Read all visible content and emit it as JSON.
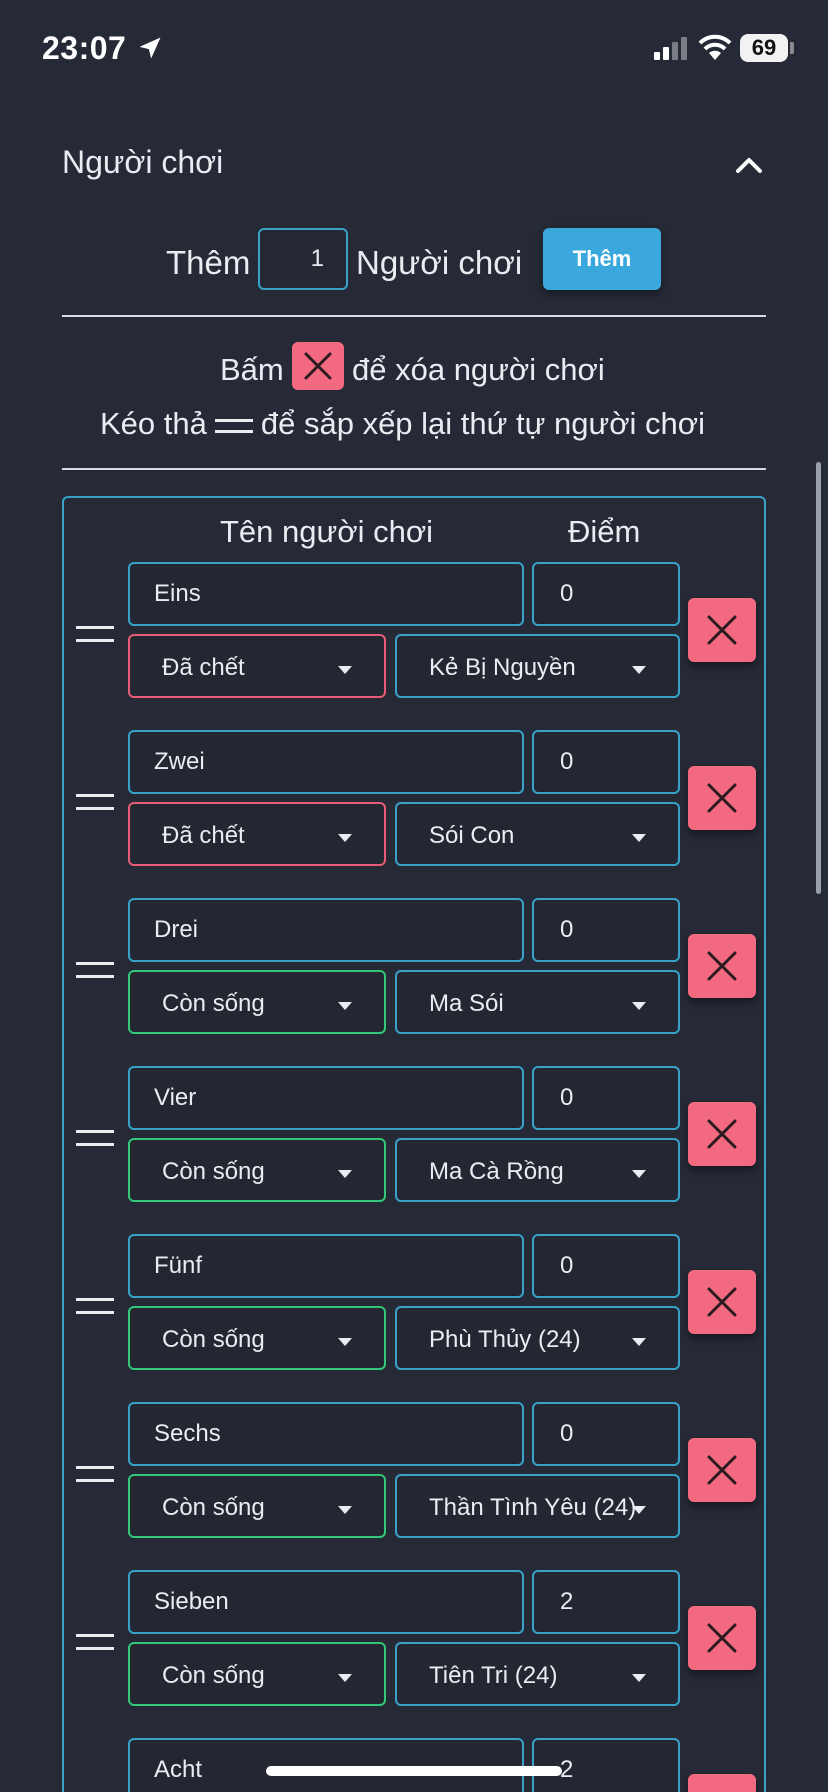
{
  "status_bar": {
    "time": "23:07",
    "battery": "69"
  },
  "section": {
    "title": "Người chơi"
  },
  "add_row": {
    "text_before": "Thêm",
    "count_value": "1",
    "text_after": "Người chơi",
    "button_label": "Thêm"
  },
  "hints": {
    "delete_before": "Bấm",
    "delete_after": "để xóa người chơi",
    "drag_before": "Kéo thả",
    "drag_after": "để sắp xếp lại thứ tự người chơi"
  },
  "table": {
    "col_name": "Tên người chơi",
    "col_score": "Điểm",
    "players": [
      {
        "name": "Eins",
        "score": "0",
        "status": "Đã chết",
        "role": "Kẻ Bị Nguyền"
      },
      {
        "name": "Zwei",
        "score": "0",
        "status": "Đã chết",
        "role": "Sói Con"
      },
      {
        "name": "Drei",
        "score": "0",
        "status": "Còn sống",
        "role": "Ma Sói"
      },
      {
        "name": "Vier",
        "score": "0",
        "status": "Còn sống",
        "role": "Ma Cà Rồng"
      },
      {
        "name": "Fünf",
        "score": "0",
        "status": "Còn sống",
        "role": "Phù Thủy (24)"
      },
      {
        "name": "Sechs",
        "score": "0",
        "status": "Còn sống",
        "role": "Thần Tình Yêu (24)"
      },
      {
        "name": "Sieben",
        "score": "2",
        "status": "Còn sống",
        "role": "Tiên Tri (24)"
      },
      {
        "name": "Acht",
        "score": "2",
        "status": "",
        "role": ""
      }
    ]
  },
  "colors": {
    "accent": "#3aa2c9",
    "dead": "#e85b74",
    "alive": "#34c77a",
    "delete": "#f36a80",
    "button": "#3aa8dc"
  }
}
